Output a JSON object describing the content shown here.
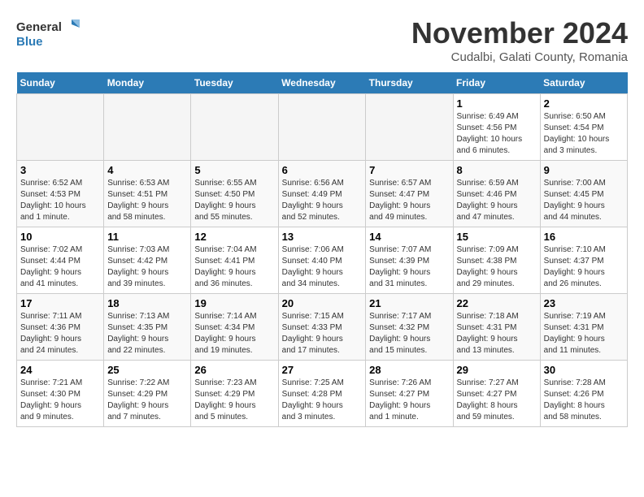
{
  "logo": {
    "line1": "General",
    "line2": "Blue"
  },
  "title": "November 2024",
  "subtitle": "Cudalbi, Galati County, Romania",
  "weekdays": [
    "Sunday",
    "Monday",
    "Tuesday",
    "Wednesday",
    "Thursday",
    "Friday",
    "Saturday"
  ],
  "weeks": [
    [
      {
        "day": "",
        "info": ""
      },
      {
        "day": "",
        "info": ""
      },
      {
        "day": "",
        "info": ""
      },
      {
        "day": "",
        "info": ""
      },
      {
        "day": "",
        "info": ""
      },
      {
        "day": "1",
        "info": "Sunrise: 6:49 AM\nSunset: 4:56 PM\nDaylight: 10 hours\nand 6 minutes."
      },
      {
        "day": "2",
        "info": "Sunrise: 6:50 AM\nSunset: 4:54 PM\nDaylight: 10 hours\nand 3 minutes."
      }
    ],
    [
      {
        "day": "3",
        "info": "Sunrise: 6:52 AM\nSunset: 4:53 PM\nDaylight: 10 hours\nand 1 minute."
      },
      {
        "day": "4",
        "info": "Sunrise: 6:53 AM\nSunset: 4:51 PM\nDaylight: 9 hours\nand 58 minutes."
      },
      {
        "day": "5",
        "info": "Sunrise: 6:55 AM\nSunset: 4:50 PM\nDaylight: 9 hours\nand 55 minutes."
      },
      {
        "day": "6",
        "info": "Sunrise: 6:56 AM\nSunset: 4:49 PM\nDaylight: 9 hours\nand 52 minutes."
      },
      {
        "day": "7",
        "info": "Sunrise: 6:57 AM\nSunset: 4:47 PM\nDaylight: 9 hours\nand 49 minutes."
      },
      {
        "day": "8",
        "info": "Sunrise: 6:59 AM\nSunset: 4:46 PM\nDaylight: 9 hours\nand 47 minutes."
      },
      {
        "day": "9",
        "info": "Sunrise: 7:00 AM\nSunset: 4:45 PM\nDaylight: 9 hours\nand 44 minutes."
      }
    ],
    [
      {
        "day": "10",
        "info": "Sunrise: 7:02 AM\nSunset: 4:44 PM\nDaylight: 9 hours\nand 41 minutes."
      },
      {
        "day": "11",
        "info": "Sunrise: 7:03 AM\nSunset: 4:42 PM\nDaylight: 9 hours\nand 39 minutes."
      },
      {
        "day": "12",
        "info": "Sunrise: 7:04 AM\nSunset: 4:41 PM\nDaylight: 9 hours\nand 36 minutes."
      },
      {
        "day": "13",
        "info": "Sunrise: 7:06 AM\nSunset: 4:40 PM\nDaylight: 9 hours\nand 34 minutes."
      },
      {
        "day": "14",
        "info": "Sunrise: 7:07 AM\nSunset: 4:39 PM\nDaylight: 9 hours\nand 31 minutes."
      },
      {
        "day": "15",
        "info": "Sunrise: 7:09 AM\nSunset: 4:38 PM\nDaylight: 9 hours\nand 29 minutes."
      },
      {
        "day": "16",
        "info": "Sunrise: 7:10 AM\nSunset: 4:37 PM\nDaylight: 9 hours\nand 26 minutes."
      }
    ],
    [
      {
        "day": "17",
        "info": "Sunrise: 7:11 AM\nSunset: 4:36 PM\nDaylight: 9 hours\nand 24 minutes."
      },
      {
        "day": "18",
        "info": "Sunrise: 7:13 AM\nSunset: 4:35 PM\nDaylight: 9 hours\nand 22 minutes."
      },
      {
        "day": "19",
        "info": "Sunrise: 7:14 AM\nSunset: 4:34 PM\nDaylight: 9 hours\nand 19 minutes."
      },
      {
        "day": "20",
        "info": "Sunrise: 7:15 AM\nSunset: 4:33 PM\nDaylight: 9 hours\nand 17 minutes."
      },
      {
        "day": "21",
        "info": "Sunrise: 7:17 AM\nSunset: 4:32 PM\nDaylight: 9 hours\nand 15 minutes."
      },
      {
        "day": "22",
        "info": "Sunrise: 7:18 AM\nSunset: 4:31 PM\nDaylight: 9 hours\nand 13 minutes."
      },
      {
        "day": "23",
        "info": "Sunrise: 7:19 AM\nSunset: 4:31 PM\nDaylight: 9 hours\nand 11 minutes."
      }
    ],
    [
      {
        "day": "24",
        "info": "Sunrise: 7:21 AM\nSunset: 4:30 PM\nDaylight: 9 hours\nand 9 minutes."
      },
      {
        "day": "25",
        "info": "Sunrise: 7:22 AM\nSunset: 4:29 PM\nDaylight: 9 hours\nand 7 minutes."
      },
      {
        "day": "26",
        "info": "Sunrise: 7:23 AM\nSunset: 4:29 PM\nDaylight: 9 hours\nand 5 minutes."
      },
      {
        "day": "27",
        "info": "Sunrise: 7:25 AM\nSunset: 4:28 PM\nDaylight: 9 hours\nand 3 minutes."
      },
      {
        "day": "28",
        "info": "Sunrise: 7:26 AM\nSunset: 4:27 PM\nDaylight: 9 hours\nand 1 minute."
      },
      {
        "day": "29",
        "info": "Sunrise: 7:27 AM\nSunset: 4:27 PM\nDaylight: 8 hours\nand 59 minutes."
      },
      {
        "day": "30",
        "info": "Sunrise: 7:28 AM\nSunset: 4:26 PM\nDaylight: 8 hours\nand 58 minutes."
      }
    ]
  ]
}
